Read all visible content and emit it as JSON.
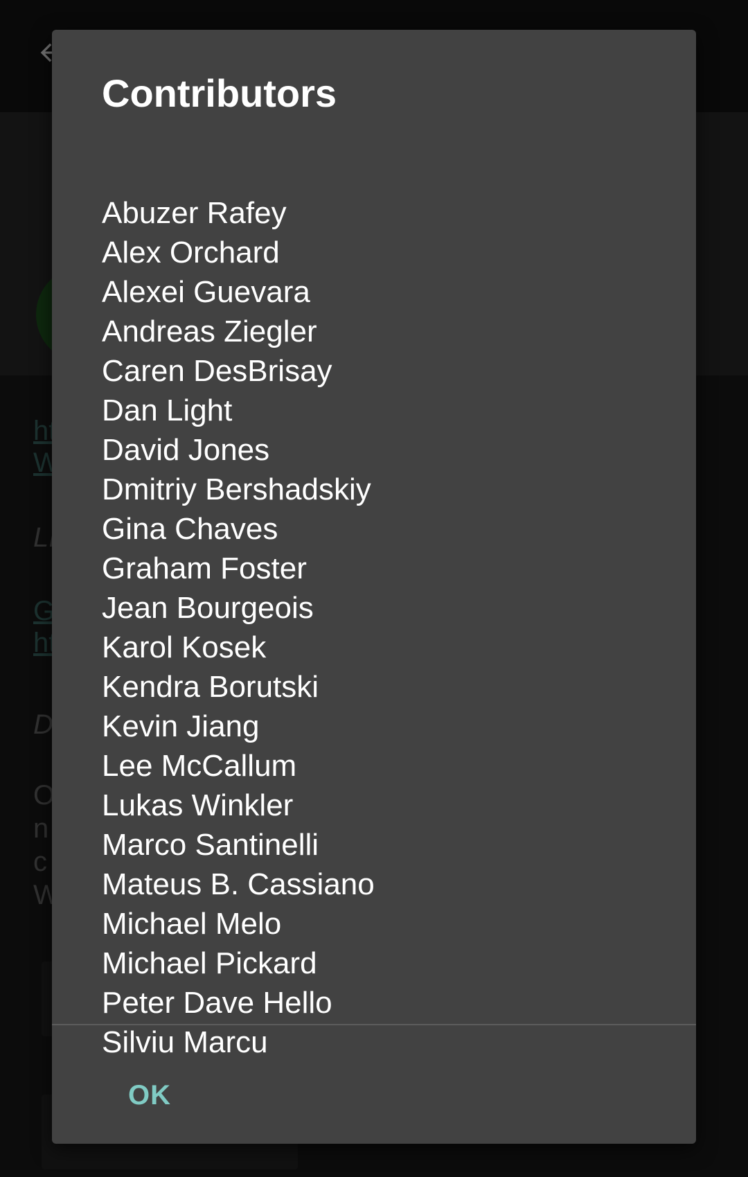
{
  "background": {
    "link_text_1": "ht",
    "link_text_2": "W",
    "italic_text_1": "LI",
    "link_text_3": "G",
    "link_text_4": "ht",
    "italic_text_2": "D",
    "body_text_1": "O",
    "body_text_2": "n",
    "body_text_3": "c",
    "body_text_4": "W"
  },
  "dialog": {
    "title": "Contributors",
    "contributors": [
      "Abuzer Rafey",
      "Alex Orchard",
      "Alexei Guevara",
      "Andreas Ziegler",
      "Caren DesBrisay",
      "Dan Light",
      "David Jones",
      "Dmitriy Bershadskiy",
      "Gina Chaves",
      "Graham Foster",
      "Jean Bourgeois",
      "Karol Kosek",
      "Kendra Borutski",
      "Kevin Jiang",
      "Lee McCallum",
      "Lukas Winkler",
      "Marco Santinelli",
      "Mateus B. Cassiano",
      "Michael Melo",
      "Michael Pickard",
      "Peter Dave Hello",
      "Silviu Marcu"
    ],
    "ok_label": "OK"
  },
  "colors": {
    "dialog_background": "#424242",
    "accent": "#80cbc4",
    "title_text": "#ffffff"
  },
  "icons": {
    "back": "arrow-back-icon"
  }
}
